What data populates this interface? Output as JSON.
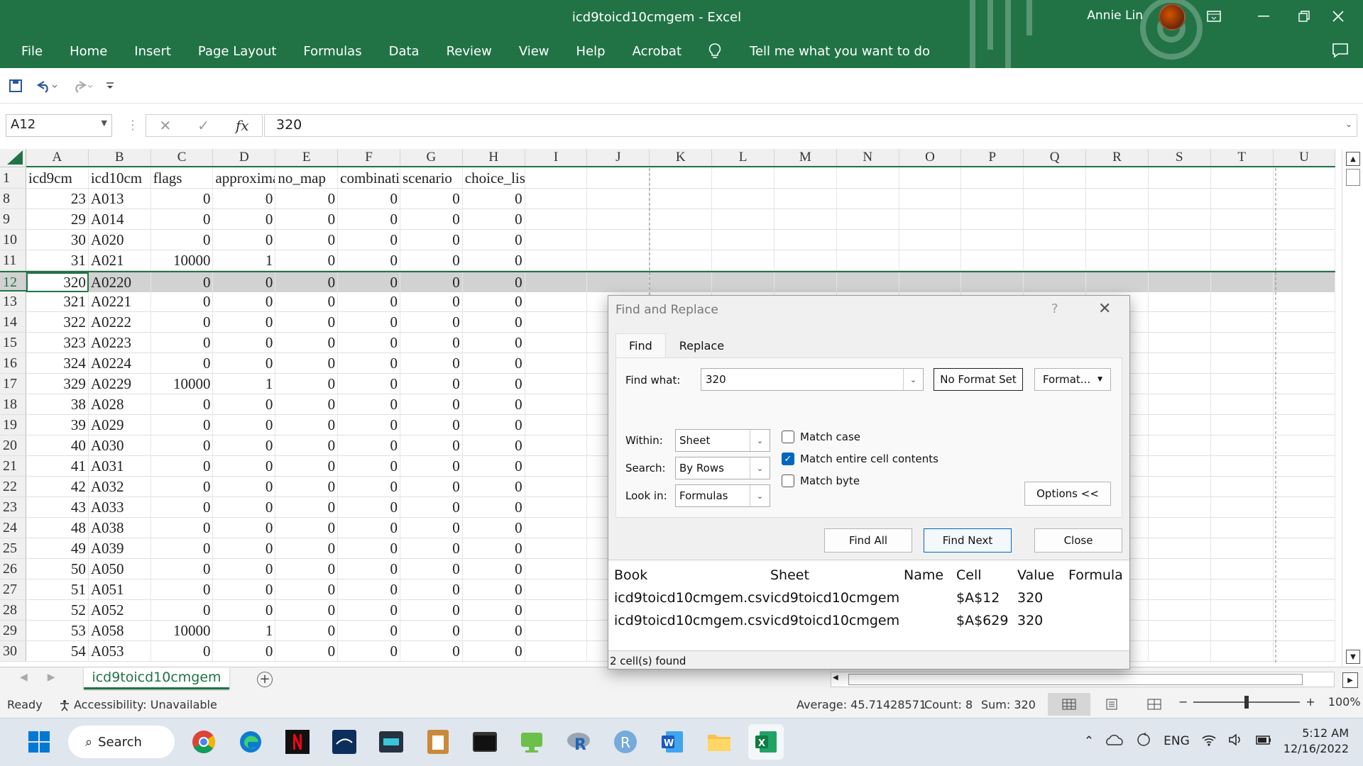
{
  "window": {
    "title": "icd9toicd10cmgem  -  Excel",
    "user": "Annie Lin"
  },
  "menu": [
    "File",
    "Home",
    "Insert",
    "Page Layout",
    "Formulas",
    "Data",
    "Review",
    "View",
    "Help",
    "Acrobat"
  ],
  "tell_me": "Tell me what you want to do",
  "name_box": "A12",
  "formula": "320",
  "columns": [
    "A",
    "B",
    "C",
    "D",
    "E",
    "F",
    "G",
    "H",
    "I",
    "J",
    "K",
    "L",
    "M",
    "N",
    "O",
    "P",
    "Q",
    "R",
    "S",
    "T",
    "U"
  ],
  "header_row": {
    "num": "1",
    "cells": [
      "icd9cm",
      "icd10cm",
      "flags",
      "approxima",
      "no_map",
      "combinati",
      "scenario",
      "choice_list"
    ]
  },
  "rows": [
    {
      "num": "8",
      "cells": [
        "23",
        "A013",
        "0",
        "0",
        "0",
        "0",
        "0",
        "0"
      ]
    },
    {
      "num": "9",
      "cells": [
        "29",
        "A014",
        "0",
        "0",
        "0",
        "0",
        "0",
        "0"
      ]
    },
    {
      "num": "10",
      "cells": [
        "30",
        "A020",
        "0",
        "0",
        "0",
        "0",
        "0",
        "0"
      ]
    },
    {
      "num": "11",
      "cells": [
        "31",
        "A021",
        "10000",
        "1",
        "0",
        "0",
        "0",
        "0"
      ]
    },
    {
      "num": "12",
      "cells": [
        "320",
        "A0220",
        "0",
        "0",
        "0",
        "0",
        "0",
        "0"
      ],
      "selected": true
    },
    {
      "num": "13",
      "cells": [
        "321",
        "A0221",
        "0",
        "0",
        "0",
        "0",
        "0",
        "0"
      ]
    },
    {
      "num": "14",
      "cells": [
        "322",
        "A0222",
        "0",
        "0",
        "0",
        "0",
        "0",
        "0"
      ]
    },
    {
      "num": "15",
      "cells": [
        "323",
        "A0223",
        "0",
        "0",
        "0",
        "0",
        "0",
        "0"
      ]
    },
    {
      "num": "16",
      "cells": [
        "324",
        "A0224",
        "0",
        "0",
        "0",
        "0",
        "0",
        "0"
      ]
    },
    {
      "num": "17",
      "cells": [
        "329",
        "A0229",
        "10000",
        "1",
        "0",
        "0",
        "0",
        "0"
      ]
    },
    {
      "num": "18",
      "cells": [
        "38",
        "A028",
        "0",
        "0",
        "0",
        "0",
        "0",
        "0"
      ]
    },
    {
      "num": "19",
      "cells": [
        "39",
        "A029",
        "0",
        "0",
        "0",
        "0",
        "0",
        "0"
      ]
    },
    {
      "num": "20",
      "cells": [
        "40",
        "A030",
        "0",
        "0",
        "0",
        "0",
        "0",
        "0"
      ]
    },
    {
      "num": "21",
      "cells": [
        "41",
        "A031",
        "0",
        "0",
        "0",
        "0",
        "0",
        "0"
      ]
    },
    {
      "num": "22",
      "cells": [
        "42",
        "A032",
        "0",
        "0",
        "0",
        "0",
        "0",
        "0"
      ]
    },
    {
      "num": "23",
      "cells": [
        "43",
        "A033",
        "0",
        "0",
        "0",
        "0",
        "0",
        "0"
      ]
    },
    {
      "num": "24",
      "cells": [
        "48",
        "A038",
        "0",
        "0",
        "0",
        "0",
        "0",
        "0"
      ]
    },
    {
      "num": "25",
      "cells": [
        "49",
        "A039",
        "0",
        "0",
        "0",
        "0",
        "0",
        "0"
      ]
    },
    {
      "num": "26",
      "cells": [
        "50",
        "A050",
        "0",
        "0",
        "0",
        "0",
        "0",
        "0"
      ]
    },
    {
      "num": "27",
      "cells": [
        "51",
        "A051",
        "0",
        "0",
        "0",
        "0",
        "0",
        "0"
      ]
    },
    {
      "num": "28",
      "cells": [
        "52",
        "A052",
        "0",
        "0",
        "0",
        "0",
        "0",
        "0"
      ]
    },
    {
      "num": "29",
      "cells": [
        "53",
        "A058",
        "10000",
        "1",
        "0",
        "0",
        "0",
        "0"
      ]
    },
    {
      "num": "30",
      "cells": [
        "54",
        "A053",
        "0",
        "0",
        "0",
        "0",
        "0",
        "0"
      ]
    }
  ],
  "sheet_tab": "icd9toicd10cmgem",
  "status": {
    "ready": "Ready",
    "accessibility": "Accessibility: Unavailable",
    "average": "Average: 45.71428571",
    "count": "Count: 8",
    "sum": "Sum: 320",
    "zoom": "100%"
  },
  "dialog": {
    "title": "Find and Replace",
    "help": "?",
    "tabs": [
      "Find",
      "Replace"
    ],
    "find_what_label": "Find what:",
    "find_what_value": "320",
    "no_format": "No Format Set",
    "format_btn": "Format...",
    "within_label": "Within:",
    "within_value": "Sheet",
    "search_label": "Search:",
    "search_value": "By Rows",
    "lookin_label": "Look in:",
    "lookin_value": "Formulas",
    "match_case": "Match case",
    "match_entire": "Match entire cell contents",
    "match_byte": "Match byte",
    "options_btn": "Options <<",
    "find_all": "Find All",
    "find_next": "Find Next",
    "close": "Close",
    "results_headers": [
      "Book",
      "Sheet",
      "Name",
      "Cell",
      "Value",
      "Formula"
    ],
    "results": [
      [
        "icd9toicd10cmgem.csv",
        "icd9toicd10cmgem",
        "",
        "$A$12",
        "320",
        ""
      ],
      [
        "icd9toicd10cmgem.csv",
        "icd9toicd10cmgem",
        "",
        "$A$629",
        "320",
        ""
      ]
    ],
    "found": "2 cell(s) found"
  },
  "taskbar": {
    "search": "Search",
    "lang": "ENG",
    "time": "5:12 AM",
    "date": "12/16/2022"
  },
  "colors": {
    "excel_green": "#217346",
    "accent_blue": "#0067c0"
  }
}
